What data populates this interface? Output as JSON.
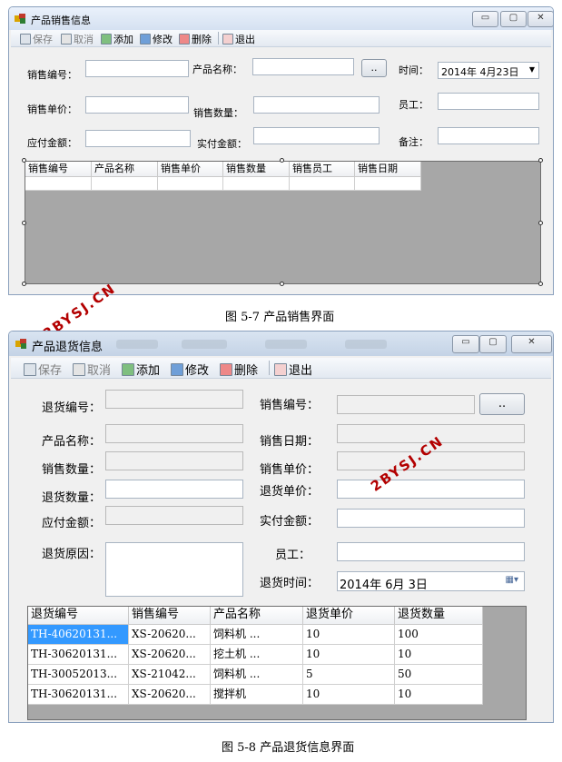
{
  "window1": {
    "title": "产品销售信息",
    "controls": {
      "minimize": "▭",
      "maximize": "▢",
      "close": "✕"
    },
    "toolbar": [
      {
        "label": "保存",
        "icon": "save-icon",
        "disabled": true
      },
      {
        "label": "取消",
        "icon": "cancel-icon",
        "disabled": true
      },
      {
        "label": "添加",
        "icon": "add-icon",
        "disabled": false
      },
      {
        "label": "修改",
        "icon": "edit-icon",
        "disabled": false
      },
      {
        "label": "删除",
        "icon": "delete-icon",
        "disabled": false
      },
      {
        "label": "退出",
        "icon": "exit-icon",
        "disabled": false
      }
    ],
    "labels": {
      "sale_no": "销售编号：",
      "product_name": "产品名称：",
      "time": "时间：",
      "unit_price": "销售单价：",
      "quantity": "销售数量：",
      "employee": "员工：",
      "payable": "应付金额：",
      "paid": "实付金额：",
      "remark": "备注："
    },
    "browse_button": "..",
    "date_value": "2014年  4月23日",
    "grid_headers": [
      "销售编号",
      "产品名称",
      "销售单价",
      "销售数量",
      "销售员工",
      "销售日期"
    ],
    "caption": "图 5-7 产品销售界面"
  },
  "window2": {
    "title": "产品退货信息",
    "controls": {
      "minimize": "▭",
      "maximize": "▢",
      "close": "✕"
    },
    "toolbar": [
      {
        "label": "保存",
        "icon": "save-icon",
        "disabled": true
      },
      {
        "label": "取消",
        "icon": "cancel-icon",
        "disabled": true
      },
      {
        "label": "添加",
        "icon": "add-icon",
        "disabled": false
      },
      {
        "label": "修改",
        "icon": "edit-icon",
        "disabled": false
      },
      {
        "label": "删除",
        "icon": "delete-icon",
        "disabled": false
      },
      {
        "label": "退出",
        "icon": "exit-icon",
        "disabled": false
      }
    ],
    "labels": {
      "return_no": "退货编号：",
      "sale_no": "销售编号：",
      "product_name": "产品名称：",
      "sale_date": "销售日期：",
      "sale_qty": "销售数量：",
      "sale_price": "销售单价：",
      "return_qty": "退货数量：",
      "return_price": "退货单价：",
      "payable": "应付金额：",
      "paid": "实付金额：",
      "reason": "退货原因：",
      "employee": "员工：",
      "return_time": "退货时间："
    },
    "browse_button": "..",
    "date_value": "2014年  6月  3日",
    "grid_headers": [
      "退货编号",
      "销售编号",
      "产品名称",
      "退货单价",
      "退货数量"
    ],
    "grid_rows": [
      [
        "TH-40620131...",
        "XS-20620...",
        "饲料机      ...",
        "10",
        "100"
      ],
      [
        "TH-30620131...",
        "XS-20620...",
        "挖土机      ...",
        "10",
        "10"
      ],
      [
        "TH-30052013...",
        "XS-21042...",
        "饲料机      ...",
        "5",
        "50"
      ],
      [
        "TH-30620131...",
        "XS-20620...",
        "搅拌机",
        "10",
        "10"
      ]
    ],
    "caption": "图 5-8 产品退货信息界面"
  },
  "watermark": "2BYSJ.CN",
  "colors": {
    "accent": "#3399ff",
    "grid_bg": "#a7a7a7",
    "watermark": "#b30000"
  }
}
